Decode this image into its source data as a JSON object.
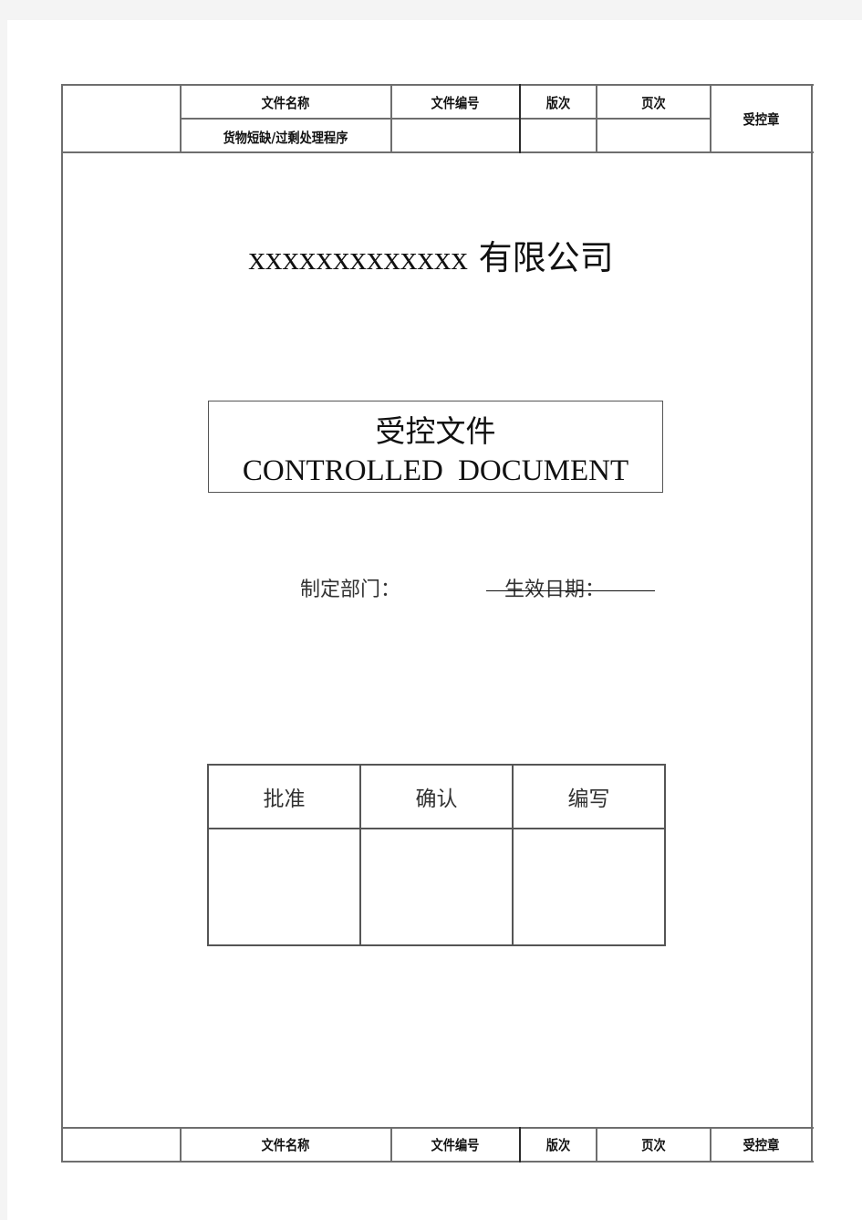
{
  "header_table": {
    "columns": [
      "文件名称",
      "文件编号",
      "版次",
      "页次"
    ],
    "values": {
      "document_name": "货物短缺/过剩处理程序",
      "document_number": "",
      "version": "",
      "page": ""
    },
    "stamp_label": "受控章"
  },
  "company": {
    "name_placeholder": "xxxxxxxxxxxxx",
    "suffix": "有限公司"
  },
  "controlled": {
    "title_cn": "受控文件",
    "title_en": "CONTROLLED  DOCUMENT"
  },
  "meta": {
    "department_label": "制定部门：",
    "department_value": "",
    "effective_date_label": "生效日期：",
    "effective_date_value": ""
  },
  "signature_table": {
    "headers": [
      "批准",
      "确认",
      "编写"
    ],
    "values": [
      "",
      "",
      ""
    ]
  },
  "footer_table": {
    "columns": [
      "文件名称",
      "文件编号",
      "版次",
      "页次"
    ],
    "stamp_label": "受控章"
  }
}
